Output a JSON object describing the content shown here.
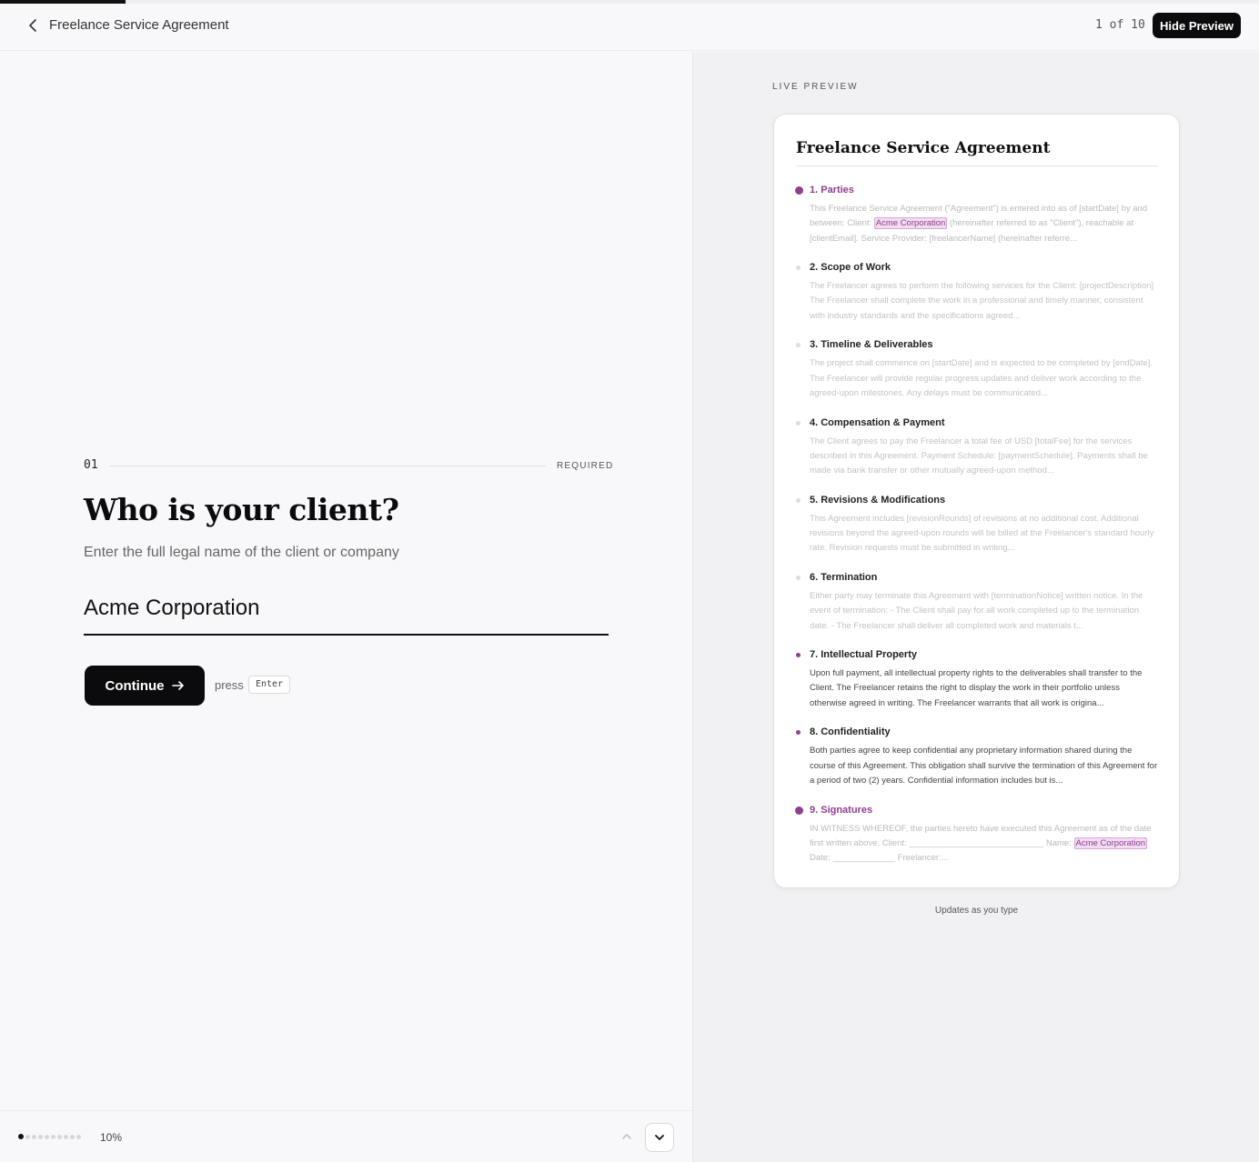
{
  "progress": {
    "fraction": 0.1
  },
  "header": {
    "back_icon": "chevron-left-icon",
    "title": "Freelance Service Agreement",
    "step_counter": "1 of 10",
    "hide_preview_label": "Hide Preview"
  },
  "question": {
    "number": "01",
    "required_label": "REQUIRED",
    "title": "Who is your client?",
    "help": "Enter the full legal name of the client or company",
    "value": "Acme Corporation",
    "continue_label": "Continue",
    "continue_icon": "arrow-right-icon",
    "press_label": "press",
    "key_hint": "Enter"
  },
  "footer": {
    "percent_label": "10%",
    "step_dots": 10,
    "current_dot": 1,
    "up_icon": "chevron-up-icon",
    "down_icon": "chevron-down-icon"
  },
  "preview": {
    "label": "LIVE PREVIEW",
    "doc_title": "Freelance Service Agreement",
    "updates_label": "Updates as you type",
    "highlight_color": "#8e3f8e",
    "sections": [
      {
        "title": "1. Parties",
        "state": "active",
        "before": "This Freelance Service Agreement (\"Agreement\") is entered into as of [startDate] by and between: Client: ",
        "highlight": "Acme Corporation",
        "after": " (hereinafter referred to as \"Client\"), reachable at [clientEmail]. Service Provider: [freelancerName] (hereinafter referre..."
      },
      {
        "title": "2. Scope of Work",
        "state": "pending",
        "before": "The Freelancer agrees to perform the following services for the Client: [projectDescription] The Freelancer shall complete the work in a professional and timely manner, consistent with industry standards and the specifications agreed...",
        "highlight": "",
        "after": ""
      },
      {
        "title": "3. Timeline & Deliverables",
        "state": "pending",
        "before": "The project shall commence on [startDate] and is expected to be completed by [endDate]. The Freelancer will provide regular progress updates and deliver work according to the agreed-upon milestones. Any delays must be communicated...",
        "highlight": "",
        "after": ""
      },
      {
        "title": "4. Compensation & Payment",
        "state": "pending",
        "before": "The Client agrees to pay the Freelancer a total fee of USD [totalFee] for the services described in this Agreement. Payment Schedule: [paymentSchedule]. Payments shall be made via bank transfer or other mutually agreed-upon method...",
        "highlight": "",
        "after": ""
      },
      {
        "title": "5. Revisions & Modifications",
        "state": "pending",
        "before": "This Agreement includes [revisionRounds] of revisions at no additional cost. Additional revisions beyond the agreed-upon rounds will be billed at the Freelancer's standard hourly rate. Revision requests must be submitted in writing...",
        "highlight": "",
        "after": ""
      },
      {
        "title": "6. Termination",
        "state": "pending",
        "before": "Either party may terminate this Agreement with [terminationNotice] written notice. In the event of termination: - The Client shall pay for all work completed up to the termination date. - The Freelancer shall deliver all completed work and materials t...",
        "highlight": "",
        "after": ""
      },
      {
        "title": "7. Intellectual Property",
        "state": "done",
        "before": "Upon full payment, all intellectual property rights to the deliverables shall transfer to the Client. The Freelancer retains the right to display the work in their portfolio unless otherwise agreed in writing. The Freelancer warrants that all work is origina...",
        "highlight": "",
        "after": ""
      },
      {
        "title": "8. Confidentiality",
        "state": "done",
        "before": "Both parties agree to keep confidential any proprietary information shared during the course of this Agreement. This obligation shall survive the termination of this Agreement for a period of two (2) years. Confidential information includes but is...",
        "highlight": "",
        "after": ""
      },
      {
        "title": "9. Signatures",
        "state": "active",
        "before": "IN WITNESS WHEREOF, the parties hereto have executed this Agreement as of the date first written above. Client: ____________________________ Name: ",
        "highlight": "Acme Corporation",
        "after": " Date: _____________ Freelancer:..."
      }
    ]
  }
}
